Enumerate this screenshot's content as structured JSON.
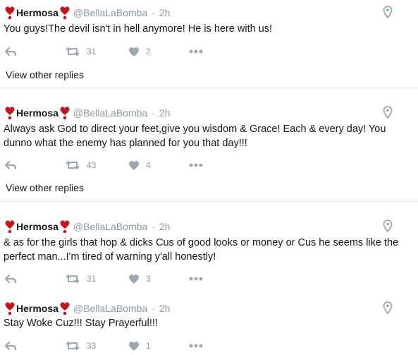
{
  "tweets": [
    {
      "name": "Hermosa",
      "handle": "@BellaLaBomba",
      "separator": "·",
      "time": "2h",
      "text": "You guys!The devil isn't in hell anymore! He is here with us!",
      "retweets": "31",
      "likes": "2",
      "view_replies": "View other replies"
    },
    {
      "name": "Hermosa",
      "handle": "@BellaLaBomba",
      "separator": "·",
      "time": "2h",
      "text": "Always ask God to direct your feet,give you wisdom & Grace! Each & every day! You dunno what the enemy has planned for you that day!!!",
      "retweets": "43",
      "likes": "4",
      "view_replies": "View other replies"
    },
    {
      "name": "Hermosa",
      "handle": "@BellaLaBomba",
      "separator": "·",
      "time": "2h",
      "text": "& as for the girls that hop & dicks Cus of good looks or money or Cus he seems like the perfect man...I'm tired of warning y'all honestly!",
      "retweets": "31",
      "likes": "3"
    },
    {
      "name": "Hermosa",
      "handle": "@BellaLaBomba",
      "separator": "·",
      "time": "2h",
      "text": "Stay Woke Cuz!!! Stay Prayerful!!!",
      "retweets": "33",
      "likes": "1"
    }
  ],
  "icons": {
    "name_emoji": "red-heart-exclamation-icon",
    "location": "location-pin-icon",
    "reply": "reply-icon",
    "retweet": "retweet-icon",
    "like": "like-heart-icon",
    "more": "more-dots-icon"
  },
  "colors": {
    "emoji_red": "#c4151c",
    "muted": "#8899a6",
    "text": "#14171a",
    "divider": "#e1e8ed"
  }
}
